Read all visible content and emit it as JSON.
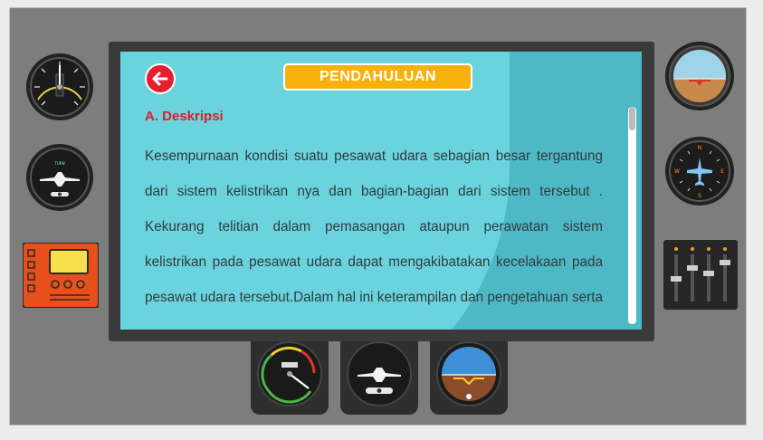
{
  "header": {
    "title": "PENDAHULUAN",
    "back_icon": "arrow-left-icon"
  },
  "content": {
    "section_heading": "A. Deskripsi",
    "paragraph": "Kesempurnaan kondisi suatu pesawat udara sebagian besar tergantung dari sistem kelistrikan nya dan bagian-bagian dari sistem tersebut . Kekurang telitian dalam pemasangan ataupun perawatan sistem kelistrikan pada pesawat udara dapat mengakibatakan kecelakaan pada pesawat udara tersebut.Dalam hal ini keterampilan dan pengetahuan serta ketelitian dalam pemasangan dan perawatan sistem kelistrikan"
  },
  "gauges": {
    "left": [
      "altimeter-gauge-icon",
      "turn-coordinator-icon",
      "radio-panel-icon"
    ],
    "right": [
      "attitude-indicator-icon",
      "heading-indicator-icon",
      "throttle-levers-icon"
    ],
    "bottom": [
      "airspeed-indicator-icon",
      "turn-indicator-icon",
      "artificial-horizon-icon"
    ]
  },
  "colors": {
    "panel": "#7d7d7d",
    "screen": "#4fb8c6",
    "accent_red": "#e5202e",
    "title_bg": "#f6b10a",
    "heading_text": "#d8212b"
  }
}
